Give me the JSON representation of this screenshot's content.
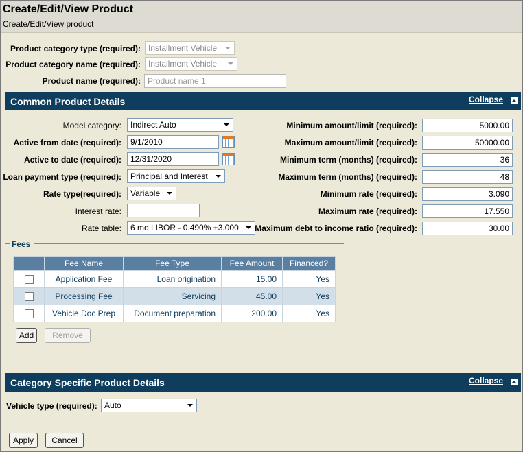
{
  "header": {
    "title": "Create/Edit/View Product",
    "subtitle": "Create/Edit/View product"
  },
  "top": {
    "cat_type_label": "Product category type (required):",
    "cat_type_value": "Installment Vehicle",
    "cat_name_label": "Product category name (required):",
    "cat_name_value": "Installment Vehicle",
    "name_label": "Product name (required):",
    "name_placeholder": "Product name 1"
  },
  "common": {
    "title": "Common Product Details",
    "collapse": "Collapse",
    "left": [
      {
        "label": "Model category:",
        "value": "Indirect Auto"
      },
      {
        "label": "Active from date (required):",
        "value": "9/1/2010"
      },
      {
        "label": "Active to date (required):",
        "value": "12/31/2020"
      },
      {
        "label": "Loan payment type (required):",
        "value": "Principal and Interest"
      },
      {
        "label": "Rate type(required):",
        "value": "Variable"
      },
      {
        "label": "Interest rate:",
        "value": ""
      },
      {
        "label": "Rate table:",
        "value": "6 mo LIBOR - 0.490% +3.000"
      }
    ],
    "right": [
      {
        "label": "Minimum amount/limit (required):",
        "value": "5000.00"
      },
      {
        "label": "Maximum amount/limit (required):",
        "value": "50000.00"
      },
      {
        "label": "Minimum term (months) (required):",
        "value": "36"
      },
      {
        "label": "Maximum term (months) (required):",
        "value": "48"
      },
      {
        "label": "Minimum rate (required):",
        "value": "3.090"
      },
      {
        "label": "Maximum rate (required):",
        "value": "17.550"
      },
      {
        "label": "Maximum debt to income ratio (required):",
        "value": "30.00"
      }
    ]
  },
  "fees": {
    "legend": "Fees",
    "columns": [
      "Fee Name",
      "Fee Type",
      "Fee Amount",
      "Financed?"
    ],
    "rows": [
      {
        "name": "Application Fee",
        "type": "Loan origination",
        "amount": "15.00",
        "financed": "Yes"
      },
      {
        "name": "Processing Fee",
        "type": "Servicing",
        "amount": "45.00",
        "financed": "Yes"
      },
      {
        "name": "Vehicle Doc Prep",
        "type": "Document preparation",
        "amount": "200.00",
        "financed": "Yes"
      }
    ],
    "add": "Add",
    "remove": "Remove"
  },
  "category": {
    "title": "Category Specific Product Details",
    "collapse": "Collapse",
    "vehicle_label": "Vehicle type (required):",
    "vehicle_value": "Auto"
  },
  "footer": {
    "apply": "Apply",
    "cancel": "Cancel"
  },
  "colors": {
    "band": "#0e3d5e",
    "table_header": "#5b7fa0",
    "row_alt": "#d3dfe8",
    "background": "#ece9d8"
  }
}
